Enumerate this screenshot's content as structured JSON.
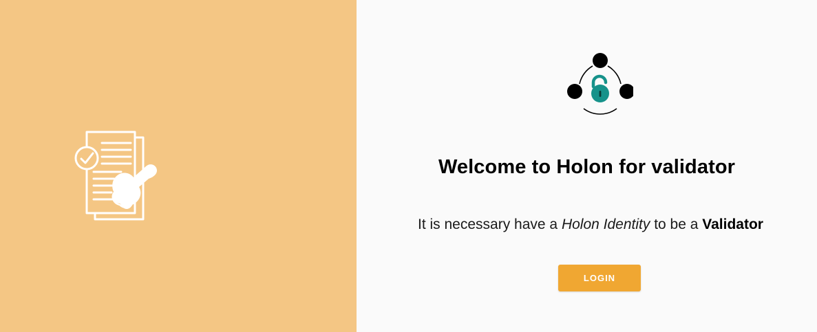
{
  "theme": {
    "left_bg": "#F4C684",
    "right_bg": "#FAFAFA",
    "accent": "#F0A732",
    "lock_color": "#16928A",
    "illustration_color": "#FFFFFF"
  },
  "illustration": {
    "icon": "document-approval-stamp-icon"
  },
  "logo": {
    "icon": "holon-lock-network-icon"
  },
  "welcome": {
    "title": "Welcome to Holon for validator"
  },
  "message": {
    "prefix": "It is necessary have a ",
    "identity": "Holon Identity",
    "middle": " to be a ",
    "role": "Validator"
  },
  "login_button": {
    "label": "LOGIN"
  }
}
